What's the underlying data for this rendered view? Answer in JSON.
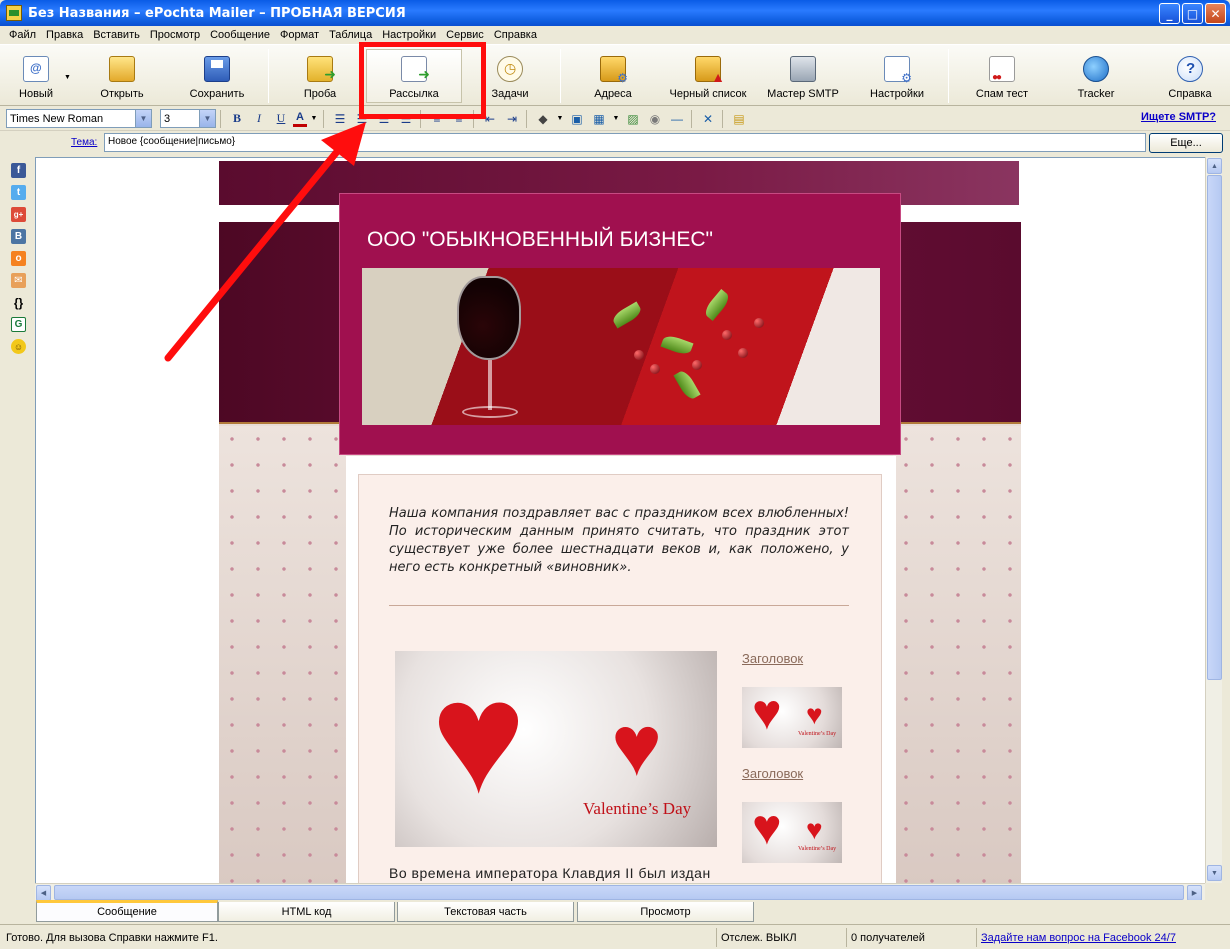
{
  "window": {
    "title": "Без Названия – ePochta Mailer – ПРОБНАЯ ВЕРСИЯ",
    "buttons": {
      "minimize": "_",
      "maximize": "□",
      "close": "✕"
    }
  },
  "menu": [
    "Файл",
    "Правка",
    "Вставить",
    "Просмотр",
    "Сообщение",
    "Формат",
    "Таблица",
    "Настройки",
    "Сервис",
    "Справка"
  ],
  "toolbar": {
    "new": "Новый",
    "open": "Открыть",
    "save": "Сохранить",
    "probe": "Проба",
    "mailing": "Рассылка",
    "tasks": "Задачи",
    "addresses": "Адреса",
    "blacklist": "Черный список",
    "smtp_master": "Мастер SMTP",
    "settings": "Настройки",
    "spam_test": "Спам тест",
    "tracker": "Tracker",
    "help": "Справка"
  },
  "format": {
    "font": "Times New Roman",
    "size": "3",
    "smtp_link": "Ищете SMTP?"
  },
  "subject": {
    "label": "Тема:",
    "value": "Новое {сообщение|письмо}",
    "more_button": "Еще..."
  },
  "email": {
    "company": "ООО \"ОБЫКНОВЕННЫЙ БИЗНЕС\"",
    "intro": "Наша компания поздравляет вас с праздником всех влюбленных! По историческим данным принято считать, что праздник этот существует уже более шестнадцати веков и, как положено, у него есть конкретный «виновник».",
    "image_caption": "Valentine’s Day",
    "thumb_caption": "Valentine’s Day",
    "link1": "Заголовок",
    "link2": "Заголовок",
    "bottom_text": "Во времена императора Клавдия II был издан"
  },
  "tabs": [
    "Сообщение",
    "HTML код",
    "Текстовая часть",
    "Просмотр"
  ],
  "active_tab": "Сообщение",
  "status": {
    "ready": "Готово. Для вызова Справки нажмите F1.",
    "tracking": "Отслеж. ВЫКЛ",
    "recipients": "0 получателей",
    "facebook_link": "Задайте нам вопрос на Facebook 24/7"
  },
  "colors": {
    "annotation_red": "#ff0d0d",
    "email_maroon": "#6d1139",
    "email_header": "#a0104f",
    "title_bar_blue": "#0a5ce6"
  },
  "side_icons": [
    "facebook-icon",
    "twitter-icon",
    "google-plus-icon",
    "vk-icon",
    "odnoklassniki-icon",
    "mail-icon",
    "braces-icon",
    "google-icon",
    "smiley-icon"
  ]
}
